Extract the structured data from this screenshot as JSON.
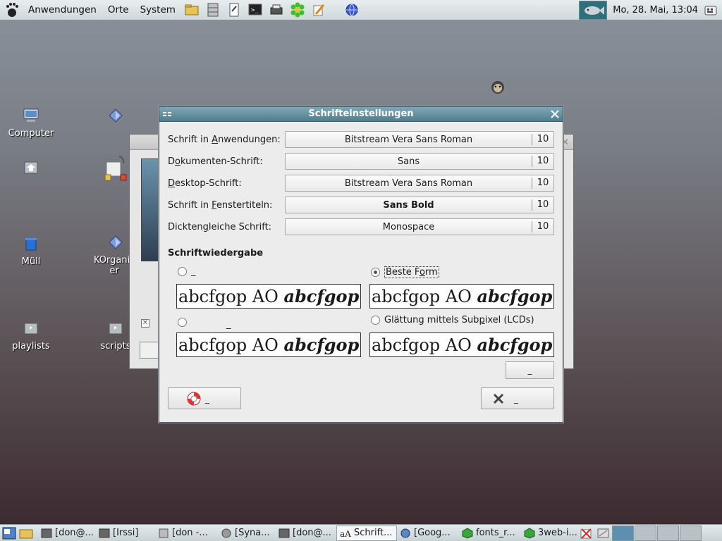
{
  "top_panel": {
    "menus": [
      "Anwendungen",
      "Orte",
      "System"
    ],
    "clock": "Mo, 28. Mai, 13:04"
  },
  "desktop_icons": [
    {
      "label": "Computer",
      "icon": "computer-icon"
    },
    {
      "label": "",
      "icon": "home-icon"
    },
    {
      "label": "Müll",
      "icon": "trash-icon"
    },
    {
      "label": "playlists",
      "icon": "folder-icon"
    },
    {
      "label": "",
      "icon": "diamond-icon"
    },
    {
      "label": "",
      "icon": "install-package-icon"
    },
    {
      "label": "KOrganizer",
      "icon": "korganizer-icon"
    },
    {
      "label": "scripts",
      "icon": "folder-icon"
    }
  ],
  "dialog": {
    "title": "Schrifteinstellungen",
    "rows": [
      {
        "label_pre": "Schrift in ",
        "label_u": "A",
        "label_post": "nwendungen:",
        "font": "Bitstream Vera Sans Roman",
        "size": "10",
        "bold": false
      },
      {
        "label_pre": "D",
        "label_u": "o",
        "label_post": "kumenten-Schrift:",
        "font": "Sans",
        "size": "10",
        "bold": false
      },
      {
        "label_pre": "",
        "label_u": "D",
        "label_post": "esktop-Schrift:",
        "font": "Bitstream Vera Sans Roman",
        "size": "10",
        "bold": false
      },
      {
        "label_pre": "Schrift in ",
        "label_u": "F",
        "label_post": "enstertiteln:",
        "font": "Sans Bold",
        "size": "10",
        "bold": true
      },
      {
        "label_pre": "Dickten",
        "label_u": "g",
        "label_post": "leiche Schrift:",
        "font": "Monospace",
        "size": "10",
        "bold": false
      }
    ],
    "rendering_title": "Schriftwiedergabe",
    "rendering_options": [
      {
        "label": "_",
        "selected": false
      },
      {
        "label_pre": "Beste F",
        "label_u": "o",
        "label_post": "rm",
        "selected": true
      },
      {
        "label": "_",
        "selected": false
      },
      {
        "label_pre": "Glättung mittels Sub",
        "label_u": "p",
        "label_post": "ixel (LCDs)",
        "selected": false
      }
    ],
    "preview_text": "abcfgop AO ",
    "preview_italic": "abcfgop",
    "details_button": "_",
    "help_button": "_",
    "close_button": "_"
  },
  "taskbar": {
    "tasks": [
      {
        "label": "[don@...",
        "icon": "terminal-icon"
      },
      {
        "label": "[Irssi]",
        "icon": "terminal-icon"
      },
      {
        "label": "[don -...",
        "icon": "file-manager-icon"
      },
      {
        "label": "[Syna...",
        "icon": "synaptic-icon"
      },
      {
        "label": "[don@...",
        "icon": "terminal-icon"
      },
      {
        "label": "Schrift...",
        "icon": "font-icon",
        "active": true
      },
      {
        "label": "[Goog...",
        "icon": "browser-icon"
      },
      {
        "label": "fonts_r...",
        "icon": "package-icon"
      },
      {
        "label": "3web-i...",
        "icon": "package-icon"
      }
    ]
  },
  "colors": {
    "title_bar": "#5f8ea0",
    "panel": "#d6dfe2",
    "dialog_bg": "#ececec"
  }
}
